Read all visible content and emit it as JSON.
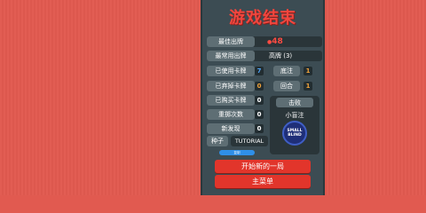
{
  "title": "游戏结束",
  "stats": {
    "best_hand_label": "最佳出牌",
    "best_hand_value": "48",
    "most_played_label": "最常用出牌",
    "most_played_value": "高牌 (3)",
    "cards_played_label": "已使用卡牌",
    "cards_played_value": "7",
    "cards_discarded_label": "已弃掉卡牌",
    "cards_discarded_value": "0",
    "cards_purchased_label": "已购买卡牌",
    "cards_purchased_value": "0",
    "rerolls_label": "重掷次数",
    "rerolls_value": "0",
    "new_discoveries_label": "新发现",
    "new_discoveries_value": "0",
    "seed_label": "种子",
    "seed_value": "TUTORIAL",
    "ante_label": "底注",
    "ante_value": "1",
    "round_label": "回合",
    "round_value": "1"
  },
  "defeated_by": {
    "label": "击败",
    "blind_name": "小盲注",
    "chip_line1": "SMALL",
    "chip_line2": "BLIND"
  },
  "copy_label": "复制",
  "buttons": {
    "new_run": "开始新的一局",
    "main_menu": "主菜单"
  },
  "colors": {
    "background": "#e15a50",
    "panel": "#3c4c53",
    "accent_red": "#e2352b",
    "blue_value": "#4ea3f5",
    "orange_value": "#f3a33a"
  }
}
